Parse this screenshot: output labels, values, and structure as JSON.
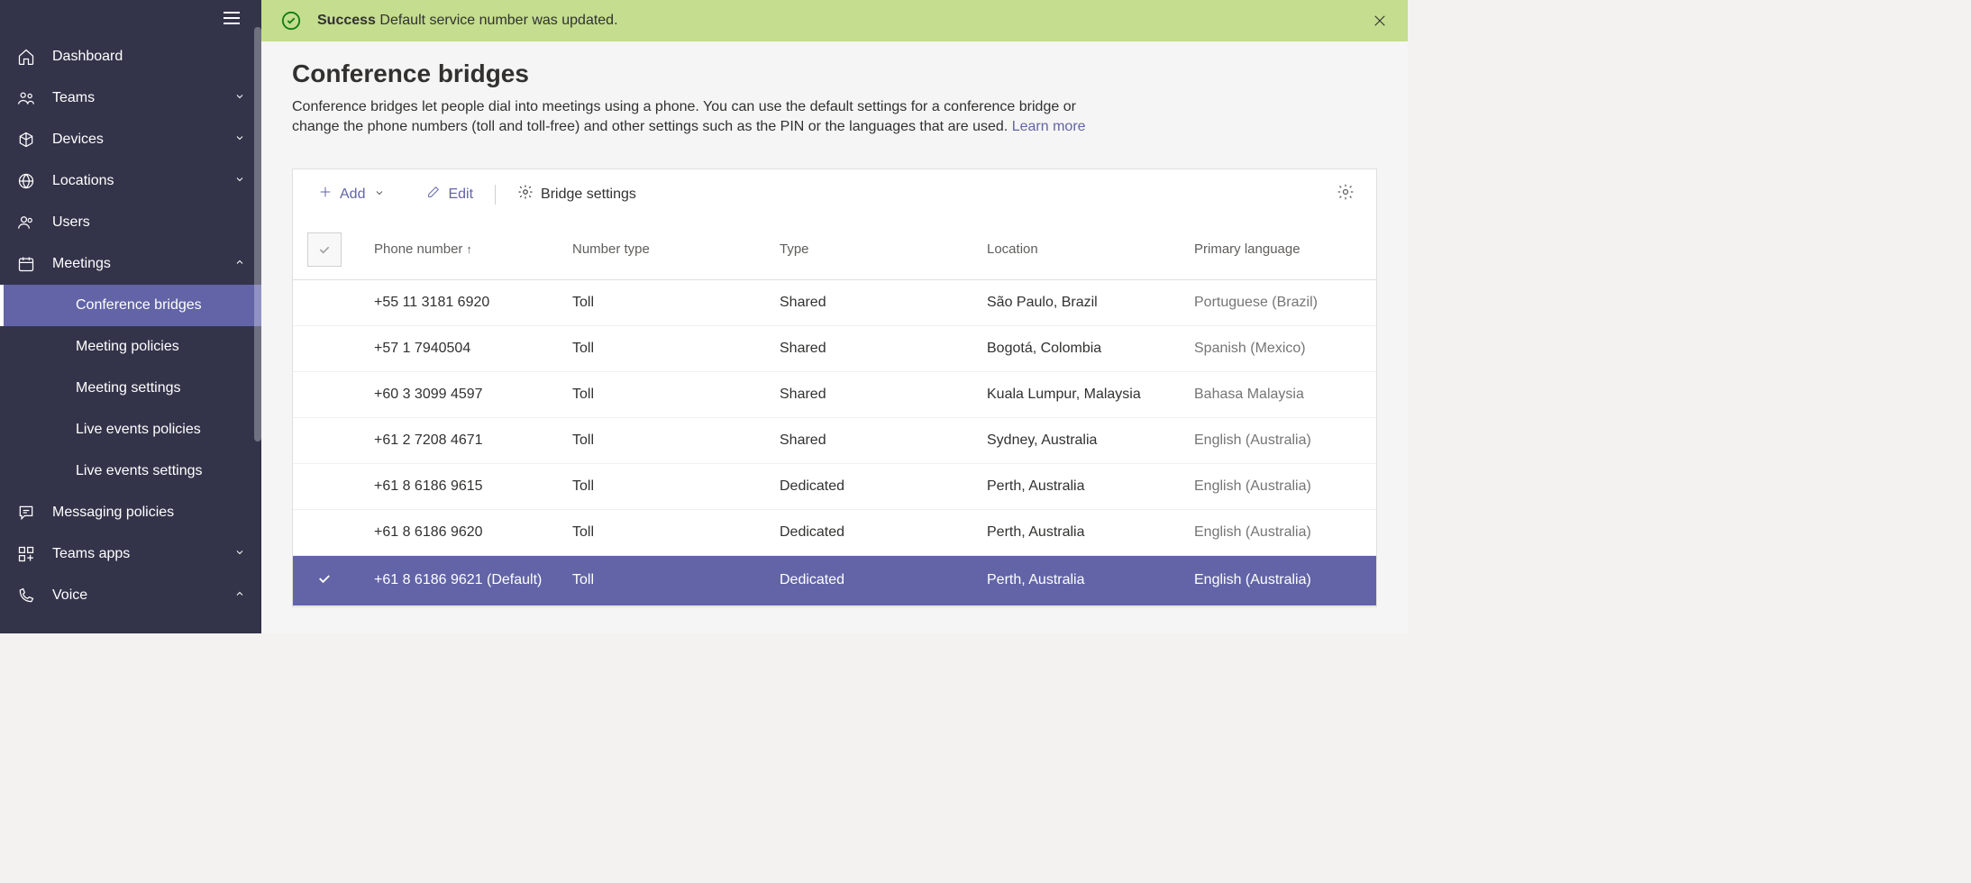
{
  "sidebar": {
    "items": [
      {
        "icon": "home",
        "label": "Dashboard",
        "chevron": false
      },
      {
        "icon": "teams",
        "label": "Teams",
        "chevron": true
      },
      {
        "icon": "device",
        "label": "Devices",
        "chevron": true
      },
      {
        "icon": "globe",
        "label": "Locations",
        "chevron": true
      },
      {
        "icon": "users",
        "label": "Users",
        "chevron": false
      },
      {
        "icon": "calendar",
        "label": "Meetings",
        "chevron": true,
        "expanded": true
      },
      {
        "icon": "chat",
        "label": "Messaging policies",
        "chevron": false
      },
      {
        "icon": "apps",
        "label": "Teams apps",
        "chevron": true
      },
      {
        "icon": "phone",
        "label": "Voice",
        "chevron": true,
        "expanded": true
      }
    ],
    "meetings_sub": [
      {
        "label": "Conference bridges",
        "active": true
      },
      {
        "label": "Meeting policies"
      },
      {
        "label": "Meeting settings"
      },
      {
        "label": "Live events policies"
      },
      {
        "label": "Live events settings"
      }
    ]
  },
  "alert": {
    "strong": "Success",
    "rest": " Default service number was updated."
  },
  "page": {
    "title": "Conference bridges",
    "desc": "Conference bridges let people dial into meetings using a phone. You can use the default settings for a conference bridge or change the phone numbers (toll and toll-free) and other settings such as the PIN or the languages that are used. ",
    "learn": "Learn more"
  },
  "toolbar": {
    "add": "Add",
    "edit": "Edit",
    "bridge": "Bridge settings"
  },
  "columns": {
    "phone": "Phone number",
    "ntype": "Number type",
    "type": "Type",
    "location": "Location",
    "lang": "Primary language"
  },
  "rows": [
    {
      "phone": "+55 11 3181 6920",
      "ntype": "Toll",
      "type": "Shared",
      "loc": "São Paulo, Brazil",
      "lang": "Portuguese (Brazil)"
    },
    {
      "phone": "+57 1 7940504",
      "ntype": "Toll",
      "type": "Shared",
      "loc": "Bogotá, Colombia",
      "lang": "Spanish (Mexico)"
    },
    {
      "phone": "+60 3 3099 4597",
      "ntype": "Toll",
      "type": "Shared",
      "loc": "Kuala Lumpur, Malaysia",
      "lang": "Bahasa Malaysia"
    },
    {
      "phone": "+61 2 7208 4671",
      "ntype": "Toll",
      "type": "Shared",
      "loc": "Sydney, Australia",
      "lang": "English (Australia)"
    },
    {
      "phone": "+61 8 6186 9615",
      "ntype": "Toll",
      "type": "Dedicated",
      "loc": "Perth, Australia",
      "lang": "English (Australia)"
    },
    {
      "phone": "+61 8 6186 9620",
      "ntype": "Toll",
      "type": "Dedicated",
      "loc": "Perth, Australia",
      "lang": "English (Australia)"
    },
    {
      "phone": "+61 8 6186 9621 (Default)",
      "ntype": "Toll",
      "type": "Dedicated",
      "loc": "Perth, Australia",
      "lang": "English (Australia)",
      "selected": true
    }
  ]
}
